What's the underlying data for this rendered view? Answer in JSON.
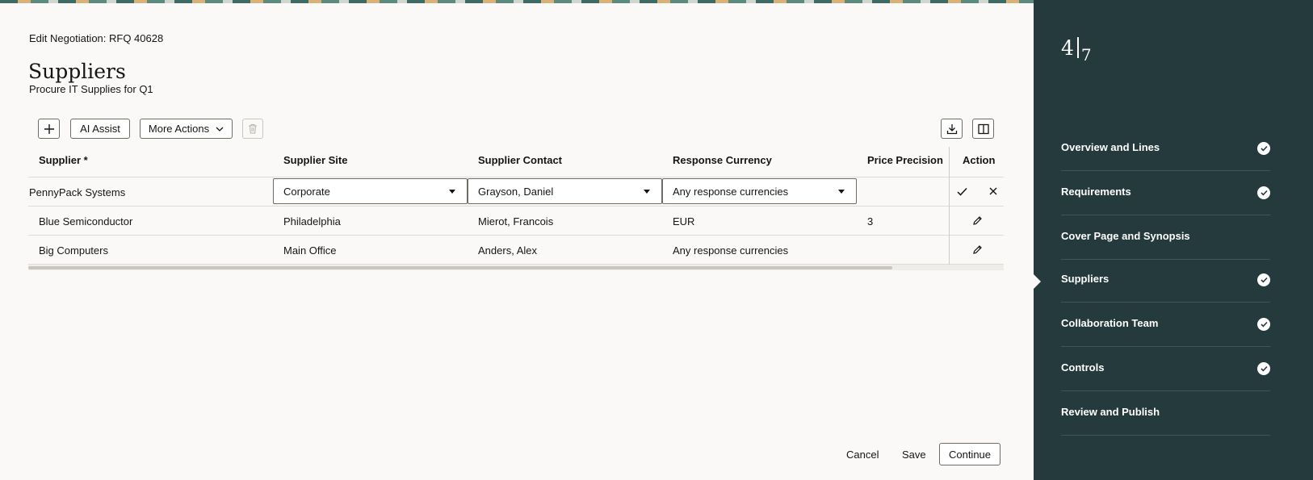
{
  "page": {
    "breadcrumb": "Edit Negotiation: RFQ 40628",
    "title": "Suppliers",
    "subtitle": "Procure IT Supplies for Q1"
  },
  "toolbar": {
    "add_icon": "plus-icon",
    "ai_assist_label": "AI Assist",
    "more_actions_label": "More Actions",
    "delete_icon": "trash-icon",
    "export_icon": "download-icon",
    "columns_icon": "columns-icon"
  },
  "table": {
    "columns": [
      "Supplier *",
      "Supplier Site",
      "Supplier Contact",
      "Response Currency",
      "Price Precision",
      "Action"
    ],
    "rows": [
      {
        "supplier": "PennyPack Systems",
        "site": "Corporate",
        "contact": "Grayson, Daniel",
        "currency": "Any response currencies",
        "precision": "",
        "editing": true
      },
      {
        "supplier": "Blue Semiconductor",
        "site": "Philadelphia",
        "contact": "Mierot, Francois",
        "currency": "EUR",
        "precision": "3"
      },
      {
        "supplier": "Big Computers",
        "site": "Main Office",
        "contact": "Anders, Alex",
        "currency": "Any response currencies",
        "precision": ""
      }
    ]
  },
  "footer": {
    "cancel_label": "Cancel",
    "save_label": "Save",
    "continue_label": "Continue"
  },
  "sidebar": {
    "current_step": "4",
    "total_steps": "7",
    "steps": [
      {
        "label": "Overview and Lines",
        "complete": true
      },
      {
        "label": "Requirements",
        "complete": true
      },
      {
        "label": "Cover Page and Synopsis",
        "complete": false
      },
      {
        "label": "Suppliers",
        "complete": true,
        "current": true
      },
      {
        "label": "Collaboration Team",
        "complete": true
      },
      {
        "label": "Controls",
        "complete": true
      },
      {
        "label": "Review and Publish",
        "complete": false
      }
    ]
  },
  "colors": {
    "sidebar_bg": "#243a3c",
    "page_bg": "#faf9f7"
  }
}
